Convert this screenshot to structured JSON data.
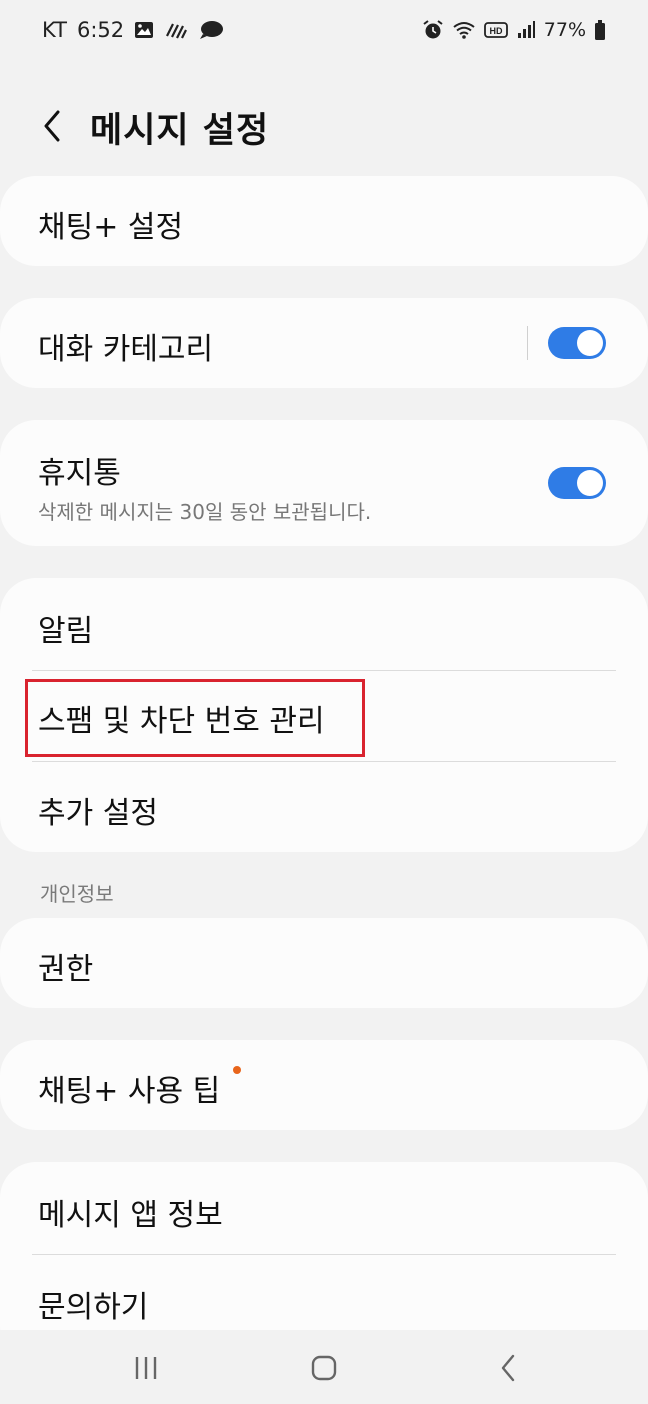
{
  "status_bar": {
    "carrier": "KT",
    "time": "6:52",
    "battery": "77%",
    "left_icons": [
      "image-icon",
      "signal-stripes-icon",
      "chat-bubble-icon"
    ],
    "right_icons": [
      "alarm-icon",
      "wifi-icon",
      "hd-voice-icon",
      "cell-signal-icon",
      "battery-icon"
    ],
    "hd_label": "HD"
  },
  "header": {
    "title": "메시지 설정",
    "back_icon": "chevron-left-icon"
  },
  "items": {
    "chat_plus_settings": "채팅+ 설정",
    "conversation_categories": "대화 카테고리",
    "trash": "휴지통",
    "trash_sub": "삭제한 메시지는 30일 동안 보관됩니다.",
    "notifications": "알림",
    "spam_block": "스팸 및 차단 번호 관리",
    "more_settings": "추가 설정",
    "privacy_section": "개인정보",
    "permissions": "권한",
    "chat_plus_tips": "채팅+ 사용 팁",
    "app_info": "메시지 앱 정보",
    "contact_us": "문의하기"
  },
  "toggles": {
    "conversation_categories": true,
    "trash": true
  },
  "colors": {
    "accent": "#2f7ce6",
    "highlight": "#d9232f",
    "badge": "#e8651b"
  },
  "nav": {
    "icons": [
      "recent-apps-icon",
      "home-icon",
      "back-icon"
    ]
  }
}
